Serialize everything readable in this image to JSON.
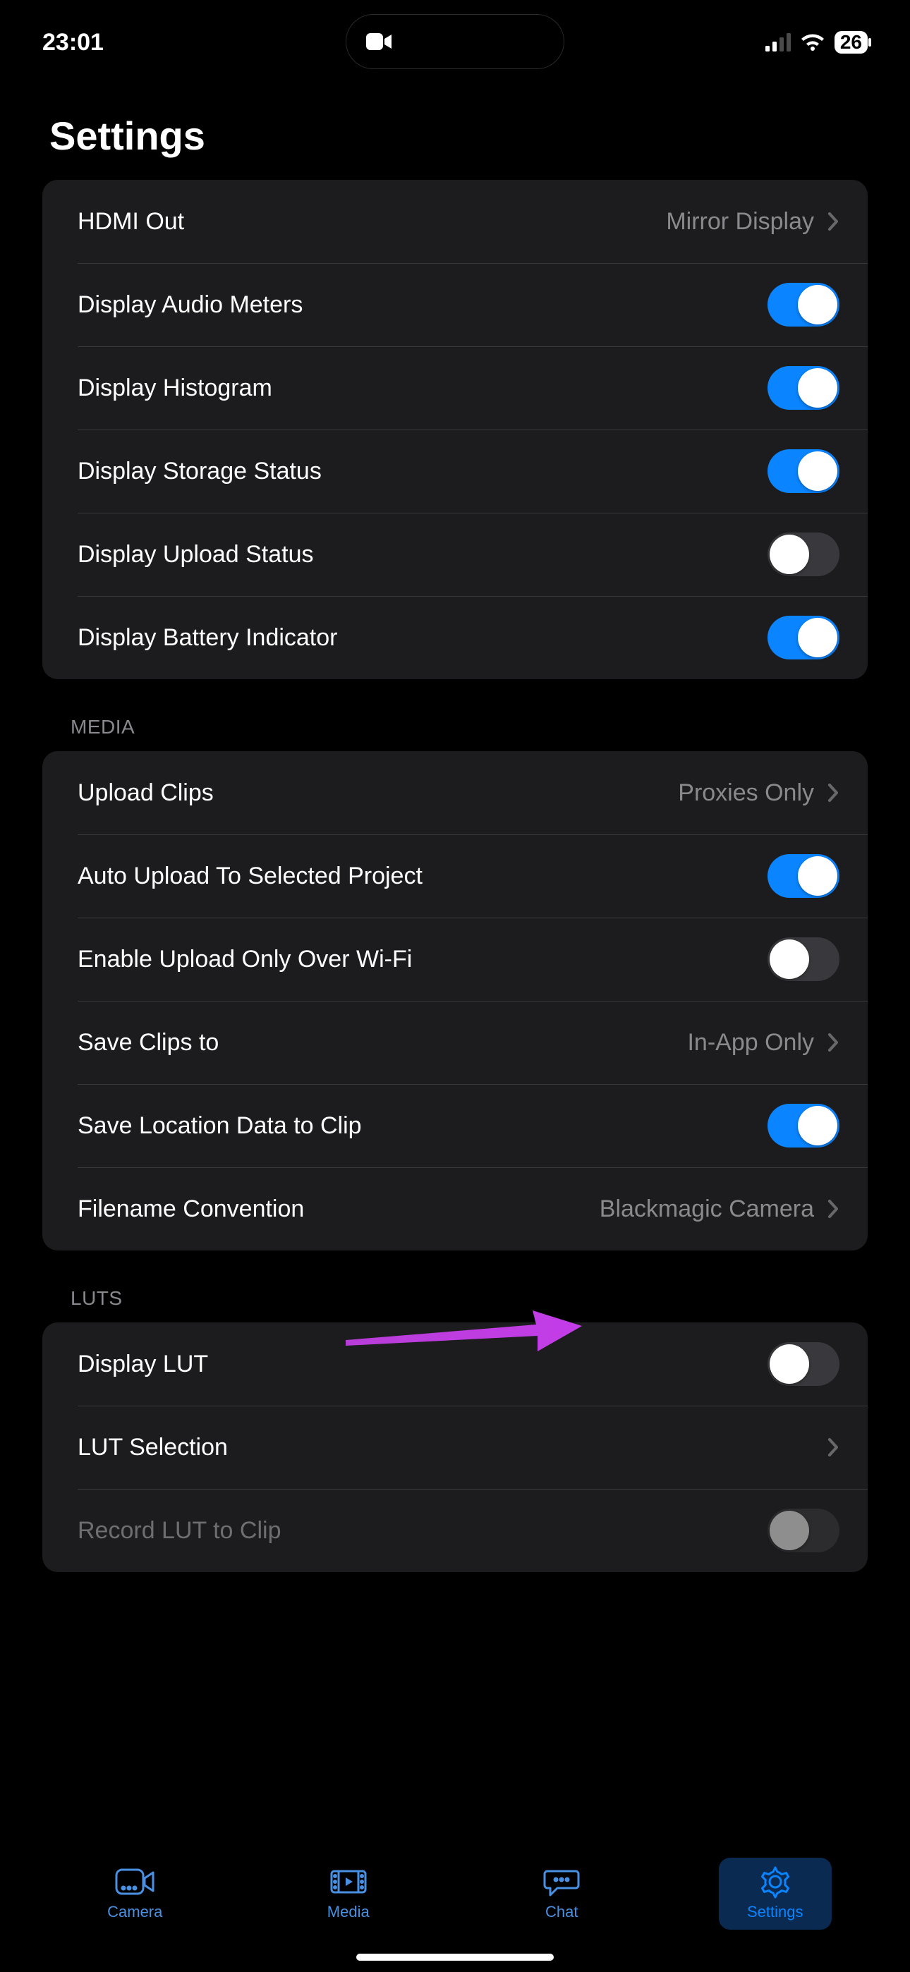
{
  "status": {
    "time": "23:01",
    "battery": "26"
  },
  "title": "Settings",
  "sections": {
    "display": {
      "rows": {
        "hdmi_out": {
          "label": "HDMI Out",
          "value": "Mirror Display"
        },
        "audio_meters": {
          "label": "Display Audio Meters",
          "on": true
        },
        "histogram": {
          "label": "Display Histogram",
          "on": true
        },
        "storage": {
          "label": "Display Storage Status",
          "on": true
        },
        "upload": {
          "label": "Display Upload Status",
          "on": false
        },
        "battery": {
          "label": "Display Battery Indicator",
          "on": true
        }
      }
    },
    "media": {
      "header": "MEDIA",
      "rows": {
        "upload_clips": {
          "label": "Upload Clips",
          "value": "Proxies Only"
        },
        "auto_upload": {
          "label": "Auto Upload To Selected Project",
          "on": true
        },
        "wifi_only": {
          "label": "Enable Upload Only Over Wi-Fi",
          "on": false
        },
        "save_clips": {
          "label": "Save Clips to",
          "value": "In-App Only"
        },
        "location": {
          "label": "Save Location Data to Clip",
          "on": true
        },
        "filename": {
          "label": "Filename Convention",
          "value": "Blackmagic Camera"
        }
      }
    },
    "luts": {
      "header": "LUTS",
      "rows": {
        "display_lut": {
          "label": "Display LUT",
          "on": false
        },
        "lut_selection": {
          "label": "LUT Selection",
          "value": ""
        },
        "record_lut": {
          "label": "Record LUT to Clip",
          "on": false,
          "disabled": true
        }
      }
    }
  },
  "tabs": {
    "camera": "Camera",
    "media": "Media",
    "chat": "Chat",
    "settings": "Settings"
  }
}
